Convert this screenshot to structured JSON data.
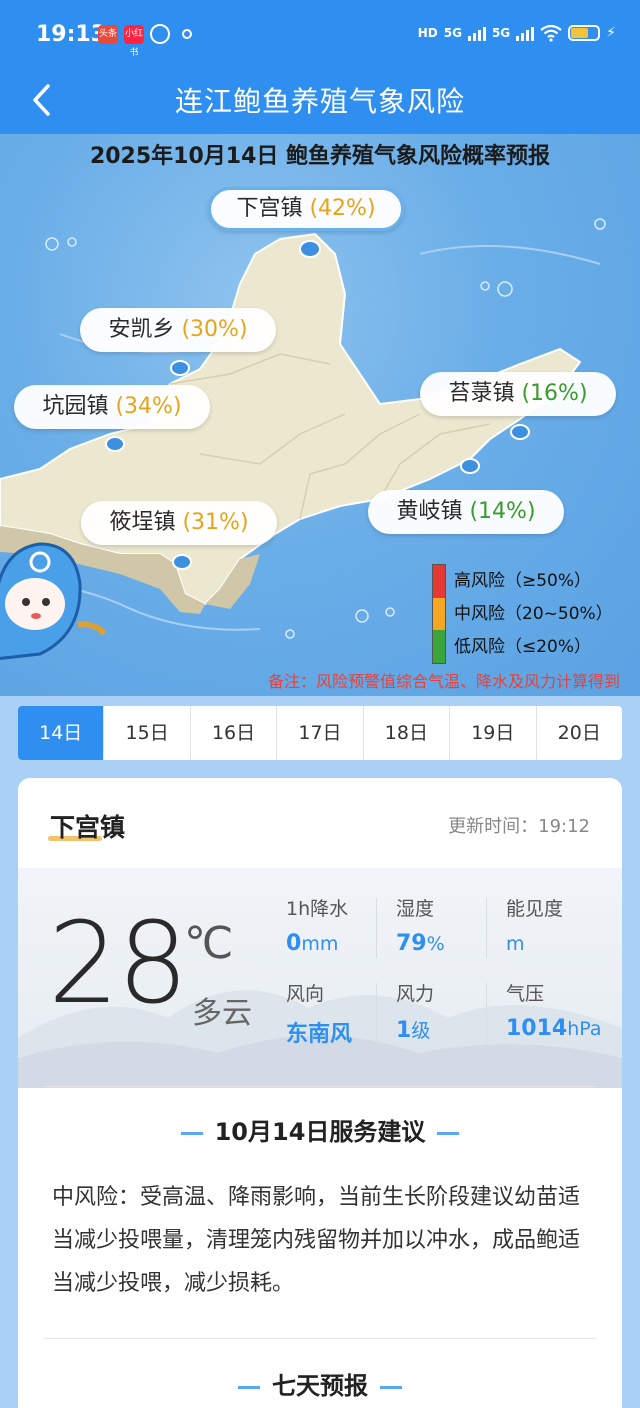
{
  "status_bar": {
    "time": "19:13",
    "apps": [
      "头条",
      "小红书"
    ],
    "hd_label": "HD",
    "network_1": "5G",
    "network_2": "5G"
  },
  "nav": {
    "title": "连江鲍鱼养殖气象风险"
  },
  "map": {
    "headline": "2025年10月14日 鲍鱼养殖气象风险概率预报",
    "towns": [
      {
        "name": "下宫镇",
        "pct": "(42%)",
        "level": "mid"
      },
      {
        "name": "安凯乡",
        "pct": "(30%)",
        "level": "mid"
      },
      {
        "name": "坑园镇",
        "pct": "(34%)",
        "level": "mid"
      },
      {
        "name": "筱埕镇",
        "pct": "(31%)",
        "level": "mid"
      },
      {
        "name": "苔菉镇",
        "pct": "(16%)",
        "level": "low"
      },
      {
        "name": "黄岐镇",
        "pct": "(14%)",
        "level": "low"
      }
    ],
    "legend": [
      {
        "label": "高风险（≥50%）",
        "color": "#e53935"
      },
      {
        "label": "中风险（20~50%）",
        "color": "#f5a623"
      },
      {
        "label": "低风险（≤20%）",
        "color": "#3aa63a"
      }
    ],
    "note": "备注：风险预警值综合气温、降水及风力计算得到"
  },
  "dates": [
    "14日",
    "15日",
    "16日",
    "17日",
    "18日",
    "19日",
    "20日"
  ],
  "active_date": "14日",
  "card": {
    "location": "下宫镇",
    "updated": "更新时间：19:12",
    "temperature": "28",
    "temp_unit": "℃",
    "condition": "多云",
    "stats": {
      "rain_label": "1h降水",
      "rain_value": "0",
      "rain_unit": "mm",
      "humidity_label": "湿度",
      "humidity_value": "79",
      "humidity_unit": "%",
      "visibility_label": "能见度",
      "visibility_value": "",
      "visibility_unit": "m",
      "wind_dir_label": "风向",
      "wind_dir_value": "东南风",
      "wind_force_label": "风力",
      "wind_force_value": "1",
      "wind_force_unit": "级",
      "pressure_label": "气压",
      "pressure_value": "1014",
      "pressure_unit": "hPa"
    },
    "advice_title": "10月14日服务建议",
    "advice_text": "中风险：受高温、降雨影响，当前生长阶段建议幼苗适当减少投喂量，清理笼内残留物并加以冲水，成品鲍适当减少投喂，减少损耗。",
    "forecast_title": "七天预报"
  },
  "colors": {
    "primary": "#2f8ff0",
    "mid_risk": "#e6a41b",
    "low_risk": "#3a9a2e",
    "note_red": "#e8413a"
  }
}
